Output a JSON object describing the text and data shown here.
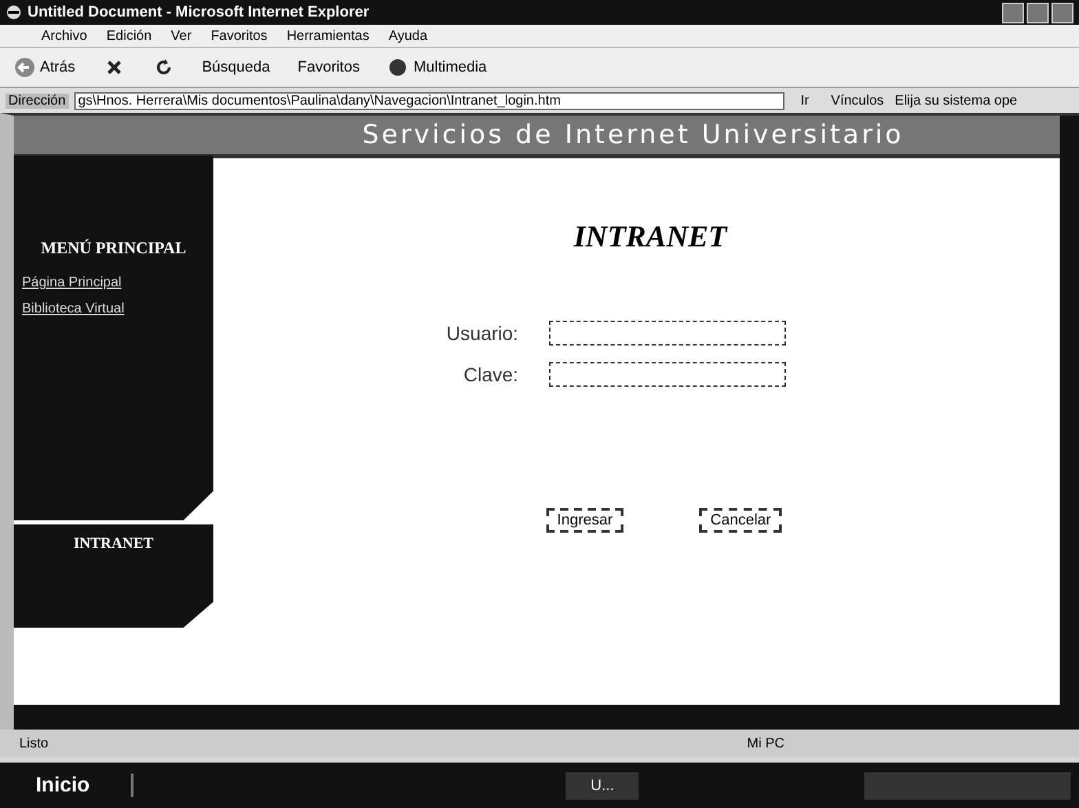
{
  "window": {
    "title": "Untitled Document - Microsoft Internet Explorer"
  },
  "menu": [
    "Archivo",
    "Edición",
    "Ver",
    "Favoritos",
    "Herramientas",
    "Ayuda"
  ],
  "toolbar": [
    {
      "kind": "back",
      "label": "Atrás"
    },
    {
      "kind": "stop"
    },
    {
      "kind": "refresh"
    },
    {
      "kind": "search",
      "label": "Búsqueda"
    },
    {
      "kind": "favorites",
      "label": "Favoritos"
    },
    {
      "kind": "media",
      "label": "Multimedia"
    }
  ],
  "address": {
    "label": "Dirección",
    "value": "gs\\Hnos. Herrera\\Mis documentos\\Paulina\\dany\\Navegacion\\Intranet_login.htm",
    "go": "Ir",
    "links": "Vínculos",
    "link_item": "Elija su sistema ope"
  },
  "banner": "Servicios de Internet Universitario",
  "sidebar": {
    "heading": "MENÚ PRINCIPAL",
    "links": [
      "Página Principal",
      "Biblioteca Virtual"
    ],
    "section": "INTRANET"
  },
  "login": {
    "title": "INTRANET",
    "fields": [
      {
        "label": "Usuario:"
      },
      {
        "label": "Clave:"
      }
    ],
    "buttons": [
      "Ingresar",
      "Cancelar"
    ]
  },
  "status_bar": {
    "text": "Listo",
    "zone": "Mi PC"
  },
  "taskbar": {
    "start": "Inicio",
    "items": [
      "U..."
    ]
  }
}
